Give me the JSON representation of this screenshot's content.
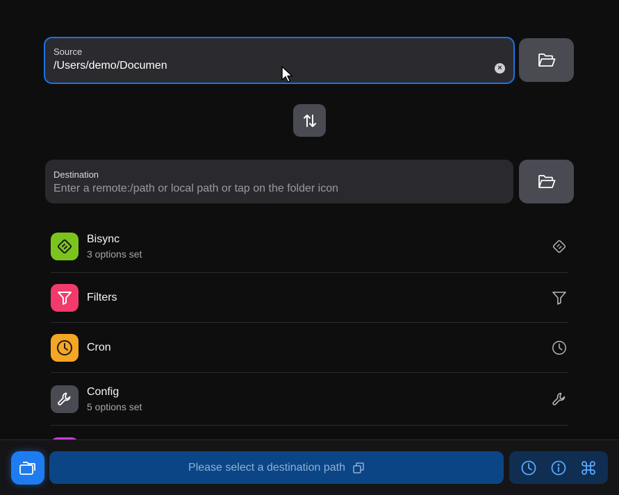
{
  "source": {
    "label": "Source",
    "value": "/Users/demo/Documen",
    "clear_glyph": "×"
  },
  "destination": {
    "label": "Destination",
    "placeholder": "Enter a remote:/path or local path or tap on the folder icon"
  },
  "icons": {
    "folder": "folder-open-icon",
    "swap": "swap-vertical-icon",
    "bisync": "bisync-icon",
    "filters": "filter-icon",
    "cron": "clock-icon",
    "config": "wrench-icon"
  },
  "options": [
    {
      "title": "Bisync",
      "subtitle": "3 options set",
      "color": "#7bc41e"
    },
    {
      "title": "Filters",
      "subtitle": "",
      "color": "#f23a6b"
    },
    {
      "title": "Cron",
      "subtitle": "",
      "color": "#f5a623"
    },
    {
      "title": "Config",
      "subtitle": "5 options set",
      "color": "#4a4a52"
    }
  ],
  "bottom": {
    "action_label": "Please select a destination path"
  },
  "colors": {
    "accent": "#1f7cf0",
    "focus_border": "#1a73e8",
    "background": "#0e0e0f"
  }
}
